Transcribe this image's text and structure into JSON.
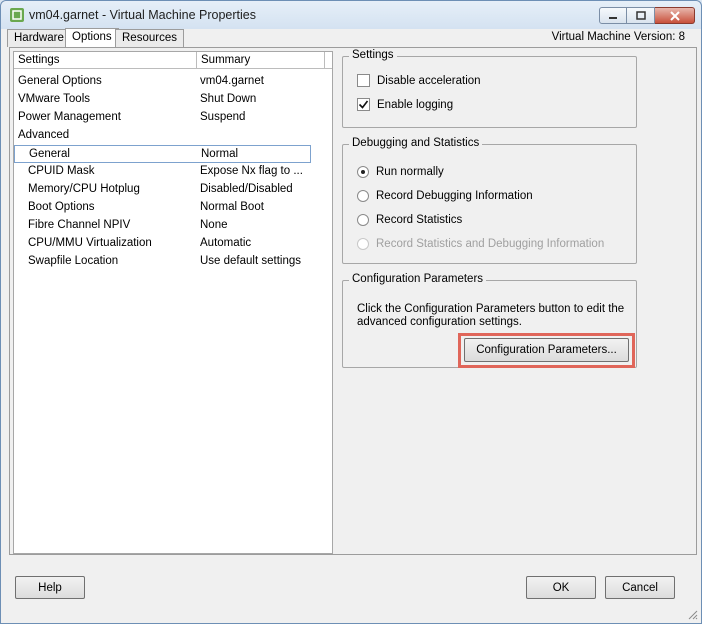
{
  "window": {
    "title": "vm04.garnet - Virtual Machine Properties",
    "version_label": "Virtual Machine Version: 8"
  },
  "tabs": [
    {
      "label": "Hardware",
      "active": false
    },
    {
      "label": "Options",
      "active": true
    },
    {
      "label": "Resources",
      "active": false
    }
  ],
  "table": {
    "headers": [
      "Settings",
      "Summary"
    ],
    "rows": [
      {
        "setting": "General Options",
        "summary": "vm04.garnet",
        "indent": 0,
        "selected": false
      },
      {
        "setting": "VMware Tools",
        "summary": "Shut Down",
        "indent": 0,
        "selected": false
      },
      {
        "setting": "Power Management",
        "summary": "Suspend",
        "indent": 0,
        "selected": false
      },
      {
        "setting": "Advanced",
        "summary": "",
        "indent": 0,
        "selected": false
      },
      {
        "setting": "General",
        "summary": "Normal",
        "indent": 1,
        "selected": true
      },
      {
        "setting": "CPUID Mask",
        "summary": "Expose Nx flag to ...",
        "indent": 1,
        "selected": false
      },
      {
        "setting": "Memory/CPU Hotplug",
        "summary": "Disabled/Disabled",
        "indent": 1,
        "selected": false
      },
      {
        "setting": "Boot Options",
        "summary": "Normal Boot",
        "indent": 1,
        "selected": false
      },
      {
        "setting": "Fibre Channel NPIV",
        "summary": "None",
        "indent": 1,
        "selected": false
      },
      {
        "setting": "CPU/MMU Virtualization",
        "summary": "Automatic",
        "indent": 1,
        "selected": false
      },
      {
        "setting": "Swapfile Location",
        "summary": "Use default settings",
        "indent": 1,
        "selected": false
      }
    ]
  },
  "settings_panel": {
    "title": "Settings",
    "disable_acceleration": {
      "label": "Disable acceleration",
      "checked": false
    },
    "enable_logging": {
      "label": "Enable logging",
      "checked": true
    }
  },
  "debug_panel": {
    "title": "Debugging and Statistics",
    "options": [
      {
        "label": "Run normally",
        "selected": true,
        "enabled": true
      },
      {
        "label": "Record Debugging Information",
        "selected": false,
        "enabled": true
      },
      {
        "label": "Record Statistics",
        "selected": false,
        "enabled": true
      },
      {
        "label": "Record Statistics and Debugging Information",
        "selected": false,
        "enabled": false
      }
    ]
  },
  "config_panel": {
    "title": "Configuration Parameters",
    "description": "Click the Configuration Parameters button to edit the advanced configuration settings.",
    "button_label": "Configuration Parameters..."
  },
  "footer": {
    "help_label": "Help",
    "ok_label": "OK",
    "cancel_label": "Cancel"
  },
  "colors": {
    "highlight": "#e0665a",
    "selection_border": "#7da2ce"
  }
}
